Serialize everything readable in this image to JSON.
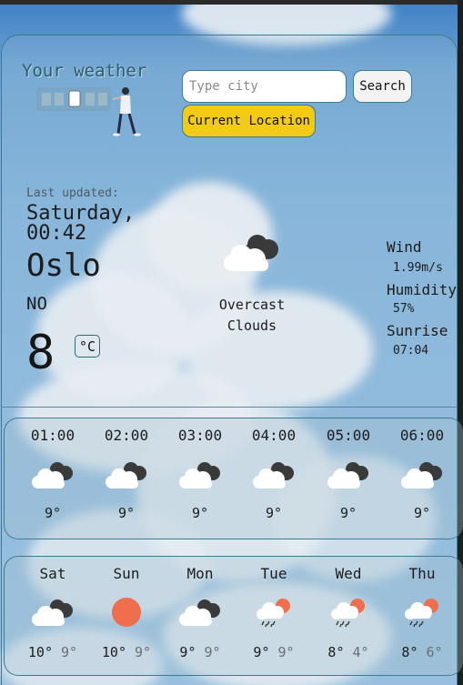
{
  "app": {
    "title": "Your weather"
  },
  "search": {
    "placeholder": "Type city",
    "search_label": "Search",
    "location_label": "Current Location"
  },
  "current": {
    "last_updated_label": "Last updated:",
    "date_text": "Saturday,\n00:42",
    "city": "Oslo",
    "country": "NO",
    "temperature": "8",
    "unit_label": "°C",
    "description": "Overcast\nClouds",
    "icon": "overcast-clouds-icon"
  },
  "stats": [
    {
      "label": "Wind",
      "value": "1.99m/s"
    },
    {
      "label": "Humidity",
      "value": "57%"
    },
    {
      "label": "Sunrise",
      "value": "07:04"
    }
  ],
  "hourly": [
    {
      "time": "01:00",
      "temp": "9°",
      "icon": "overcast-clouds-icon"
    },
    {
      "time": "02:00",
      "temp": "9°",
      "icon": "overcast-clouds-icon"
    },
    {
      "time": "03:00",
      "temp": "9°",
      "icon": "overcast-clouds-icon"
    },
    {
      "time": "04:00",
      "temp": "9°",
      "icon": "overcast-clouds-icon"
    },
    {
      "time": "05:00",
      "temp": "9°",
      "icon": "overcast-clouds-icon"
    },
    {
      "time": "06:00",
      "temp": "9°",
      "icon": "overcast-clouds-icon"
    }
  ],
  "daily": [
    {
      "day": "Sat",
      "max": "10°",
      "min": "9°",
      "icon": "overcast-clouds-icon"
    },
    {
      "day": "Sun",
      "max": "10°",
      "min": "9°",
      "icon": "sun-icon"
    },
    {
      "day": "Mon",
      "max": "9°",
      "min": "9°",
      "icon": "overcast-clouds-icon"
    },
    {
      "day": "Tue",
      "max": "9°",
      "min": "9°",
      "icon": "rain-icon"
    },
    {
      "day": "Wed",
      "max": "8°",
      "min": "4°",
      "icon": "rain-icon"
    },
    {
      "day": "Thu",
      "max": "8°",
      "min": "6°",
      "icon": "rain-icon"
    }
  ],
  "colors": {
    "accent_border": "#3f7b90",
    "location_button": "#f2cb12",
    "sun": "#ee6e4e"
  }
}
